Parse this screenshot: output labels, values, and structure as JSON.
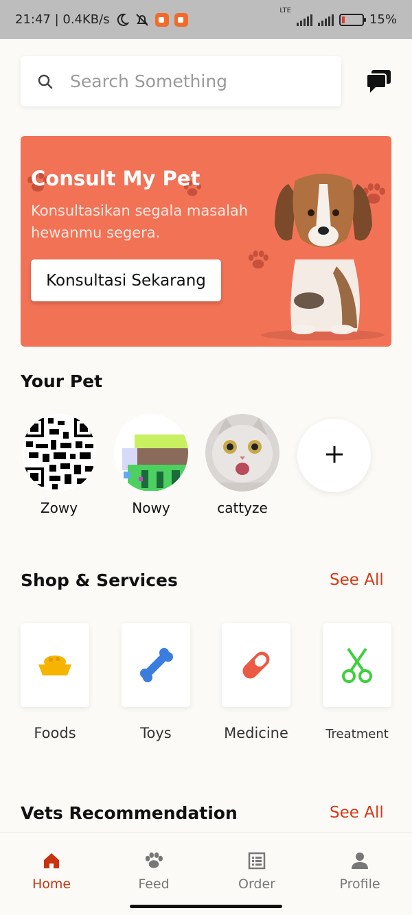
{
  "status_bar": {
    "time_speed": "21:47 | 0.4KB/s",
    "network": "LTE",
    "battery_percent": "15%",
    "battery_level": 0.15
  },
  "search": {
    "placeholder": "Search Something"
  },
  "banner": {
    "title": "Consult My Pet",
    "subtitle": "Konsultasikan segala masalah hewanmu segera.",
    "cta": "Konsultasi Sekarang",
    "color": "#f27256"
  },
  "your_pet": {
    "title": "Your Pet",
    "pets": [
      {
        "name": "Zowy",
        "avatar": "qr-pattern"
      },
      {
        "name": "Nowy",
        "avatar": "pixel-house"
      },
      {
        "name": "cattyze",
        "avatar": "cat-photo"
      }
    ],
    "add_icon": "plus-icon"
  },
  "shop": {
    "title": "Shop & Services",
    "see_all": "See All",
    "items": [
      {
        "label": "Foods",
        "icon": "food-bowl-icon",
        "color": "#f5b400"
      },
      {
        "label": "Toys",
        "icon": "bone-icon",
        "color": "#3b7ddd"
      },
      {
        "label": "Medicine",
        "icon": "pill-icon",
        "color": "#ea5a44"
      },
      {
        "label": "Treatment",
        "icon": "scissors-icon",
        "color": "#3fcf3f"
      }
    ]
  },
  "vets": {
    "title": "Vets Recommendation",
    "see_all": "See All"
  },
  "nav": {
    "items": [
      {
        "label": "Home",
        "icon": "home-icon"
      },
      {
        "label": "Feed",
        "icon": "paw-icon"
      },
      {
        "label": "Order",
        "icon": "list-icon"
      },
      {
        "label": "Profile",
        "icon": "person-icon"
      }
    ],
    "active_color": "#c7340f"
  }
}
